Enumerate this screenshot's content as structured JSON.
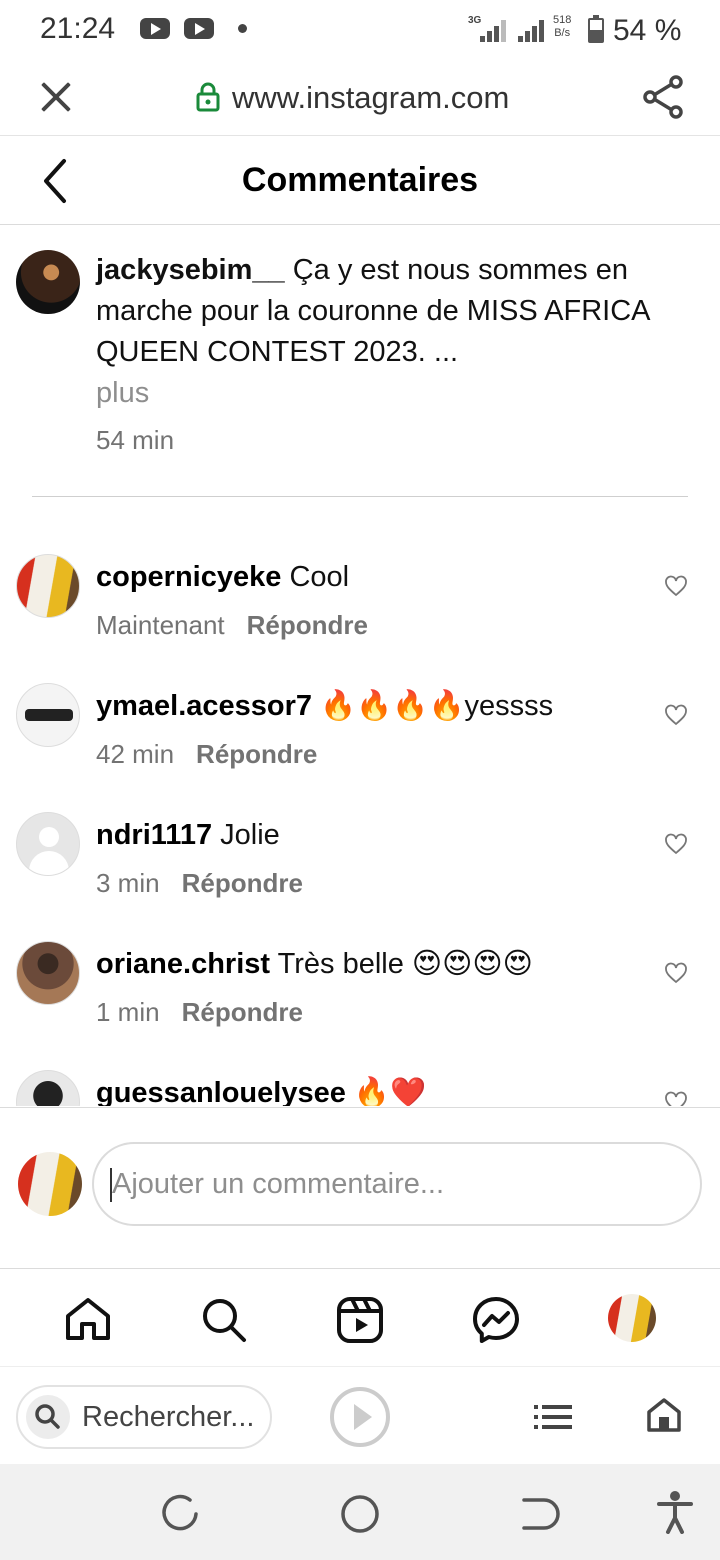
{
  "status_bar": {
    "time": "21:24",
    "network": "3G",
    "speed_value": "518",
    "speed_unit": "B/s",
    "battery": "54 %",
    "battery_level": 0.54
  },
  "browser": {
    "url": "www.instagram.com"
  },
  "header": {
    "title": "Commentaires"
  },
  "caption": {
    "username": "jackysebim__",
    "text": "Ça y est nous sommes en marche pour la couronne de MISS AFRICA QUEEN CONTEST 2023. ...",
    "more": "plus",
    "time": "54 min"
  },
  "comments": [
    {
      "username": "copernicyeke",
      "text": "Cool",
      "time": "Maintenant",
      "reply": "Répondre",
      "avatar": "red-yellow-photo"
    },
    {
      "username": "ymael.acessor7",
      "text": "🔥🔥🔥🔥yessss",
      "time": "42 min",
      "reply": "Répondre",
      "avatar": "sunglasses-photo"
    },
    {
      "username": "ndri1117",
      "text": "Jolie",
      "time": "3 min",
      "reply": "Répondre",
      "avatar": "default-avatar"
    },
    {
      "username": "oriane.christ",
      "text": "Très belle 😍😍😍😍",
      "time": "1 min",
      "reply": "Répondre",
      "avatar": "portrait-photo"
    },
    {
      "username": "guessanlouelysee",
      "text": "🔥❤️",
      "time": "",
      "reply": "",
      "avatar": "portrait-photo"
    }
  ],
  "add_comment": {
    "placeholder": "Ajouter un commentaire..."
  },
  "bottom_nav": {
    "items": [
      "home-icon",
      "search-icon",
      "reels-icon",
      "messenger-icon",
      "profile-avatar"
    ]
  },
  "browser_bar": {
    "search_label": "Rechercher..."
  },
  "colors": {
    "secure_lock": "#1a8a3a",
    "muted_text": "#737373",
    "divider": "#dbdbdb"
  }
}
